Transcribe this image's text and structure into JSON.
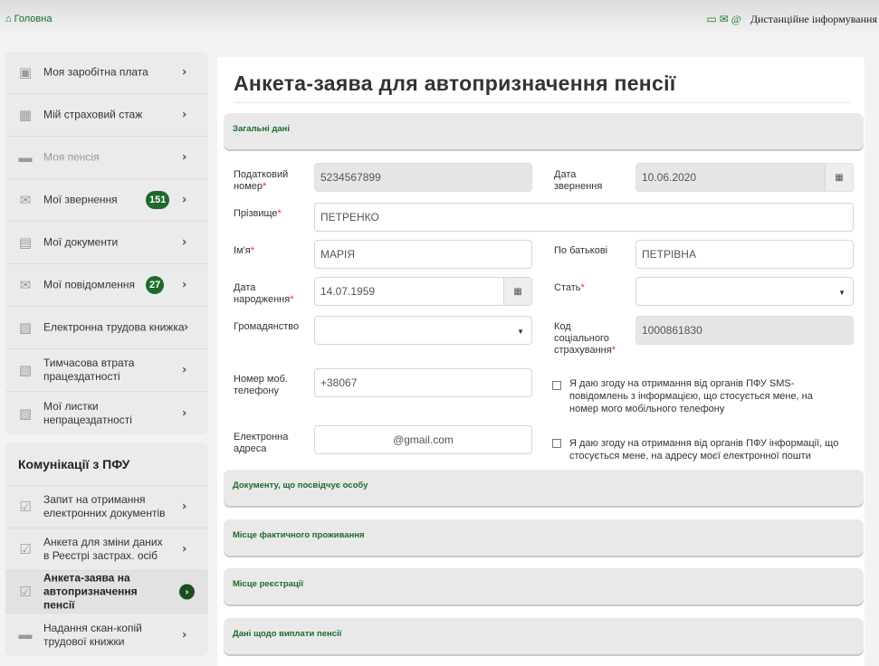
{
  "breadcrumb": {
    "home": "Головна"
  },
  "header": {
    "remote_label": "Дистанційне інформування"
  },
  "sidebar": {
    "items": [
      {
        "label": "Моя заробітна плата",
        "icon": "wallet-icon"
      },
      {
        "label": "Мій страховий стаж",
        "icon": "calendar-icon"
      },
      {
        "label": "Моя пенсія",
        "icon": "folder-icon"
      },
      {
        "label": "Мої звернення",
        "icon": "envelope-icon",
        "badge": "151"
      },
      {
        "label": "Мої документи",
        "icon": "document-icon"
      },
      {
        "label": "Мої повідомлення",
        "icon": "message-icon",
        "badge": "27"
      },
      {
        "label": "Електронна трудова книжка",
        "icon": "book-icon"
      },
      {
        "label": "Тимчасова втрата працездатності",
        "icon": "book-icon"
      },
      {
        "label": "Мої листки непрацездатності",
        "icon": "book-icon"
      }
    ],
    "comm_title": "Комунікації з ПФУ",
    "comm_items": [
      {
        "label": "Запит на отримання електронних документів",
        "icon": "checkbox-icon"
      },
      {
        "label": "Анкета для зміни даних в Реєстрі застрах. осіб",
        "icon": "checkbox-icon"
      },
      {
        "label": "Анкета-заява на автопризначення пенсії",
        "icon": "checkbox-icon",
        "active": true
      },
      {
        "label": "Надання скан-копій трудової книжки",
        "icon": "folder-icon"
      }
    ]
  },
  "form": {
    "title": "Анкета-заява для автопризначення пенсії",
    "sections": {
      "general": "Загальні дані",
      "identity_doc": "Документу, що посвідчує особу",
      "residence": "Місце фактичного проживання",
      "registration": "Місце реєстрації",
      "payment": "Дані щодо виплати пенсії"
    },
    "tax_number": {
      "label": "Податковий номер",
      "value": "5234567899"
    },
    "request_date": {
      "label": "Дата звернення",
      "value": "10.06.2020"
    },
    "surname": {
      "label": "Прізвище",
      "value": "ПЕТРЕНКО"
    },
    "first_name": {
      "label": "Ім'я",
      "value": "МАРІЯ"
    },
    "patronymic": {
      "label": "По батькові",
      "value": "ПЕТРІВНА"
    },
    "birth_date": {
      "label": "Дата народження",
      "value": "14.07.1959"
    },
    "sex": {
      "label": "Стать",
      "value": ""
    },
    "citizenship": {
      "label": "Громадянство",
      "value": ""
    },
    "social_code": {
      "label": "Код соціального страхування",
      "value": "1000861830"
    },
    "phone": {
      "label": "Номер моб. телефону",
      "value": "+38067"
    },
    "email": {
      "label": "Електронна адреса",
      "value": "@gmail.com"
    },
    "consent_sms": "Я даю згоду на отримання від органів ПФУ SMS-повідомлень з інформацією, що стосується мене, на номер мого мобільного телефону",
    "consent_email": "Я даю згоду на отримання від органів ПФУ інформації, що стосується мене, на адресу моєї електронної пошти",
    "required_mark": "*"
  },
  "colors": {
    "accent": "#1d6a2c",
    "required": "#dd3333",
    "section_bg": "#e9e9e9"
  }
}
